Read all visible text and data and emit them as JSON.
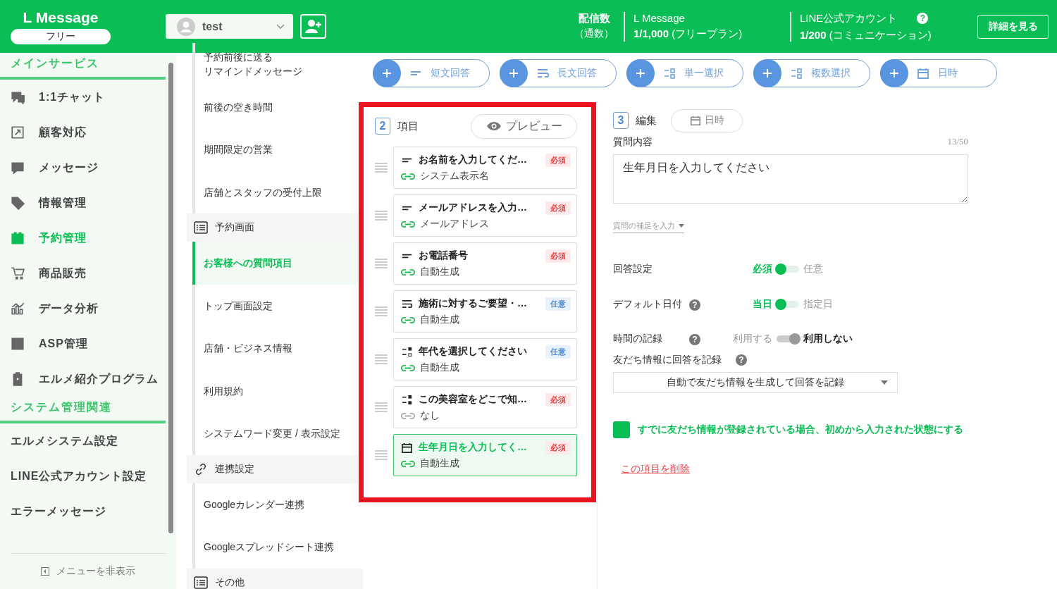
{
  "header": {
    "logo": "L Message",
    "plan": "フリー",
    "account": {
      "name": "test"
    },
    "stats_label": "配信数",
    "stats_sub": "（通数）",
    "stats": [
      {
        "title": "L Message",
        "value": "**1/1,000** (フリープラン)"
      },
      {
        "title": "LINE公式アカウント",
        "value": "**1/200** (コミュニケーション)",
        "help": "?"
      }
    ],
    "details_button": "詳細を見る"
  },
  "sidebar": {
    "sections": [
      {
        "title": "メインサービス",
        "items": [
          {
            "label": "1:1チャット",
            "kind": "chat",
            "selected": false
          },
          {
            "label": "顧客対応",
            "kind": "arrow",
            "selected": false
          },
          {
            "label": "メッセージ",
            "kind": "edit",
            "selected": false
          },
          {
            "label": "情報管理",
            "kind": "tag",
            "selected": false
          },
          {
            "label": "予約管理",
            "kind": "calendar",
            "selected": true
          },
          {
            "label": "商品販売",
            "kind": "cart",
            "selected": false
          },
          {
            "label": "データ分析",
            "kind": "chart",
            "selected": false
          },
          {
            "label": "ASP管理",
            "kind": "box",
            "selected": false
          },
          {
            "label": "エルメ紹介プログラム",
            "kind": "badge",
            "selected": false
          }
        ]
      },
      {
        "title": "システム管理関連",
        "items": [
          {
            "label": "エルメシステム設定",
            "kind": "plain",
            "selected": false
          },
          {
            "label": "LINE公式アカウント設定",
            "kind": "plain",
            "selected": false
          },
          {
            "label": "エラーメッセージ",
            "kind": "plain",
            "selected": false
          }
        ]
      }
    ],
    "hide_menu": "メニューを非表示"
  },
  "subnav": [
    {
      "kind": "item",
      "lines": [
        "予約前後に送る",
        "リマインドメッセージ"
      ],
      "selected": false
    },
    {
      "kind": "item",
      "lines": [
        "前後の空き時間"
      ],
      "selected": false
    },
    {
      "kind": "item",
      "lines": [
        "期間限定の営業"
      ],
      "selected": false
    },
    {
      "kind": "item",
      "lines": [
        "店舗とスタッフの受付上限"
      ],
      "selected": false
    },
    {
      "kind": "list_group",
      "label": "予約画面"
    },
    {
      "kind": "item",
      "lines": [
        "お客様への質問項目"
      ],
      "selected": true
    },
    {
      "kind": "item",
      "lines": [
        "トップ画面設定"
      ],
      "selected": false
    },
    {
      "kind": "item",
      "lines": [
        "店舗・ビジネス情報"
      ],
      "selected": false
    },
    {
      "kind": "item",
      "lines": [
        "利用規約"
      ],
      "selected": false
    },
    {
      "kind": "item",
      "lines": [
        "システムワード変更 / 表示設定"
      ],
      "selected": false
    },
    {
      "kind": "link_group",
      "label": "連携設定"
    },
    {
      "kind": "item",
      "lines": [
        "Googleカレンダー連携"
      ],
      "selected": false
    },
    {
      "kind": "item",
      "lines": [
        "Googleスプレッドシート連携"
      ],
      "selected": false
    },
    {
      "kind": "list_group",
      "label": "その他"
    }
  ],
  "add_buttons": [
    {
      "label": "短文回答",
      "kind": "short"
    },
    {
      "label": "長文回答",
      "kind": "long"
    },
    {
      "label": "単一選択",
      "kind": "single"
    },
    {
      "label": "複数選択",
      "kind": "multi"
    },
    {
      "label": "日時",
      "kind": "date"
    }
  ],
  "items_panel": {
    "step": "2",
    "title": "項目",
    "preview": "プレビュー",
    "items": [
      {
        "kind": "short",
        "title": "お名前を入力してくだ…",
        "badge": {
          "label": "必須",
          "kind": "required"
        },
        "link": "システム表示名",
        "linked": true,
        "selected": false
      },
      {
        "kind": "short",
        "title": "メールアドレスを入力…",
        "badge": {
          "label": "必須",
          "kind": "required"
        },
        "link": "メールアドレス",
        "linked": true,
        "selected": false
      },
      {
        "kind": "short",
        "title": "お電話番号",
        "badge": {
          "label": "必須",
          "kind": "required"
        },
        "link": "自動生成",
        "linked": true,
        "selected": false
      },
      {
        "kind": "long",
        "title": "施術に対するご要望・…",
        "badge": {
          "label": "任意",
          "kind": "optional"
        },
        "link": "自動生成",
        "linked": true,
        "selected": false
      },
      {
        "kind": "single",
        "title": "年代を選択してください",
        "badge": {
          "label": "任意",
          "kind": "optional"
        },
        "link": "自動生成",
        "linked": true,
        "selected": false
      },
      {
        "kind": "multi",
        "title": "この美容室をどこで知…",
        "badge": {
          "label": "必須",
          "kind": "required"
        },
        "link": "なし",
        "linked": false,
        "selected": false
      },
      {
        "kind": "date",
        "title": "生年月日を入力してく…",
        "badge": {
          "label": "必須",
          "kind": "required"
        },
        "link": "自動生成",
        "linked": true,
        "selected": true
      }
    ]
  },
  "edit_panel": {
    "step": "3",
    "title": "編集",
    "type_chip": "日時",
    "question_label": "質問内容",
    "counter": "13/50",
    "question_value": "生年月日を入力してください",
    "supplement": "質問の補足を入力",
    "toggles": [
      {
        "label": "回答設定",
        "options": [
          {
            "label": "必須",
            "selected": true
          },
          {
            "label": "任意",
            "selected": false
          }
        ]
      },
      {
        "label": "デフォルト日付",
        "help": "?",
        "options": [
          {
            "label": "当日",
            "selected": true
          },
          {
            "label": "指定日",
            "selected": false
          }
        ]
      },
      {
        "label": "時間の記録",
        "help": "?",
        "options": [
          {
            "label": "利用する",
            "selected": false
          },
          {
            "label": "利用しない",
            "selected": true
          }
        ]
      }
    ],
    "record_label": "友だち情報に回答を記録",
    "record_help": "?",
    "record_select": "自動で友だち情報を生成して回答を記録",
    "prefill": {
      "label": "すでに友だち情報が登録されている場合、初めから入力された状態にする",
      "checked": true
    },
    "delete_link": "この項目を削除"
  }
}
